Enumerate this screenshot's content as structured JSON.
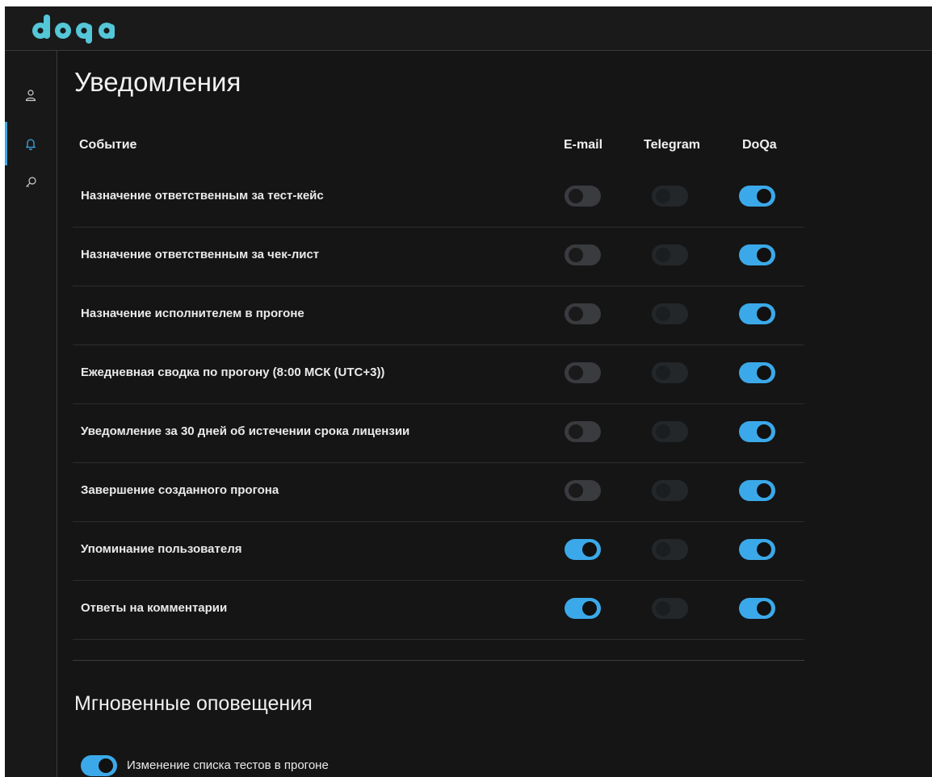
{
  "app": {
    "logo_text": "doqa"
  },
  "sidebar": {
    "items": [
      {
        "icon": "user-icon",
        "active": false
      },
      {
        "icon": "bell-icon",
        "active": true
      },
      {
        "icon": "key-icon",
        "active": false
      }
    ]
  },
  "page": {
    "title": "Уведомления",
    "columns": {
      "event": "Событие",
      "email": "E-mail",
      "telegram": "Telegram",
      "doqa": "DoQa"
    },
    "rows": [
      {
        "label": "Назначение ответственным за тест-кейс",
        "email": false,
        "telegram": false,
        "doqa": true
      },
      {
        "label": "Назначение ответственным за чек-лист",
        "email": false,
        "telegram": false,
        "doqa": true
      },
      {
        "label": "Назначение исполнителем в прогоне",
        "email": false,
        "telegram": false,
        "doqa": true
      },
      {
        "label": "Ежедневная сводка по прогону (8:00 МСК (UTC+3))",
        "email": false,
        "telegram": false,
        "doqa": true
      },
      {
        "label": "Уведомление за 30 дней об истечении срока лицензии",
        "email": false,
        "telegram": false,
        "doqa": true
      },
      {
        "label": "Завершение созданного прогона",
        "email": false,
        "telegram": false,
        "doqa": true
      },
      {
        "label": "Упоминание пользователя",
        "email": true,
        "telegram": false,
        "doqa": true
      },
      {
        "label": "Ответы на комментарии",
        "email": true,
        "telegram": false,
        "doqa": true
      }
    ],
    "telegram_disabled": true
  },
  "instant": {
    "title": "Мгновенные оповещения",
    "items": [
      {
        "label": "Изменение списка тестов в прогоне",
        "on": true
      }
    ]
  },
  "colors": {
    "accent": "#3ba9e9",
    "background": "#151515",
    "toggle_off": "#3a3b3f"
  }
}
